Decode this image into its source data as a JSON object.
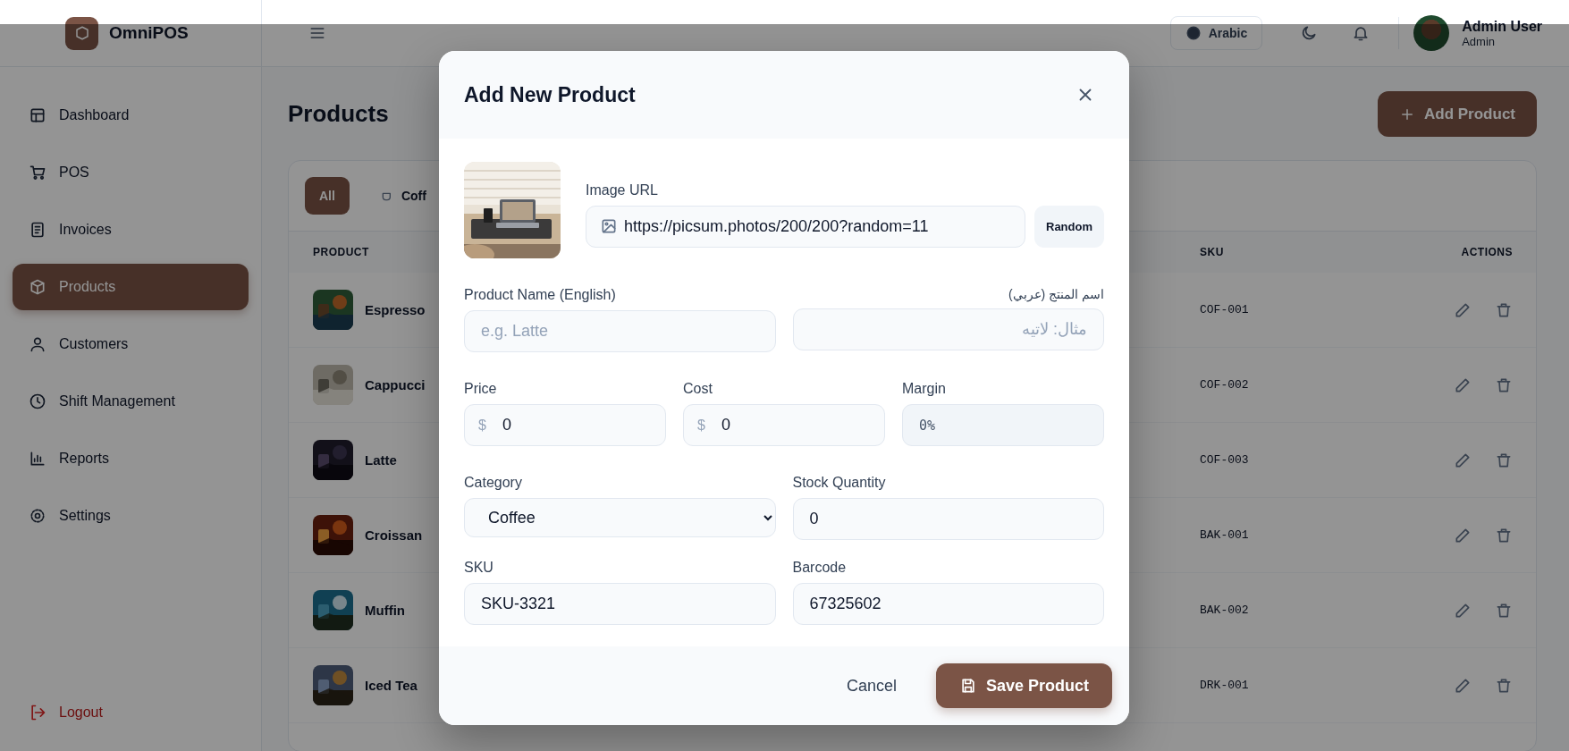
{
  "brand": "OmniPOS",
  "header": {
    "language_button": "Arabic",
    "user": {
      "name": "Admin User",
      "role": "Admin"
    }
  },
  "sidebar": {
    "items": [
      {
        "label": "Dashboard",
        "selected": false
      },
      {
        "label": "POS",
        "selected": false
      },
      {
        "label": "Invoices",
        "selected": false
      },
      {
        "label": "Products",
        "selected": true
      },
      {
        "label": "Customers",
        "selected": false
      },
      {
        "label": "Shift Management",
        "selected": false
      },
      {
        "label": "Reports",
        "selected": false
      },
      {
        "label": "Settings",
        "selected": false
      }
    ],
    "logout": "Logout"
  },
  "page": {
    "title": "Products",
    "add_button": "Add Product",
    "filters": [
      {
        "label": "All",
        "selected": true
      },
      {
        "label": "Coff",
        "selected": false
      }
    ],
    "table": {
      "columns": [
        "PRODUCT",
        "SKU",
        "ACTIONS"
      ],
      "rows": [
        {
          "name": "Espresso",
          "sku": "COF-001"
        },
        {
          "name": "Cappucci",
          "sku": "COF-002"
        },
        {
          "name": "Latte",
          "sku": "COF-003"
        },
        {
          "name": "Croissan",
          "sku": "BAK-001"
        },
        {
          "name": "Muffin",
          "sku": "BAK-002"
        },
        {
          "name": "Iced Tea",
          "sku": "DRK-001"
        }
      ]
    }
  },
  "modal": {
    "title": "Add New Product",
    "image_url": {
      "label": "Image URL",
      "value": "https://picsum.photos/200/200?random=11",
      "button": "Random"
    },
    "name_en": {
      "label": "Product Name (English)",
      "placeholder": "e.g. Latte"
    },
    "name_ar": {
      "label": "اسم المنتج (عربي)",
      "placeholder": "مثال: لاتيه"
    },
    "price": {
      "label": "Price",
      "prefix": "$",
      "value": "0"
    },
    "cost": {
      "label": "Cost",
      "prefix": "$",
      "value": "0"
    },
    "margin": {
      "label": "Margin",
      "value": "0%"
    },
    "category": {
      "label": "Category",
      "value": "Coffee"
    },
    "stock": {
      "label": "Stock Quantity",
      "value": "0"
    },
    "sku": {
      "label": "SKU",
      "value": "SKU-3321"
    },
    "barcode": {
      "label": "Barcode",
      "value": "67325602"
    },
    "cancel": "Cancel",
    "save": "Save Product"
  }
}
